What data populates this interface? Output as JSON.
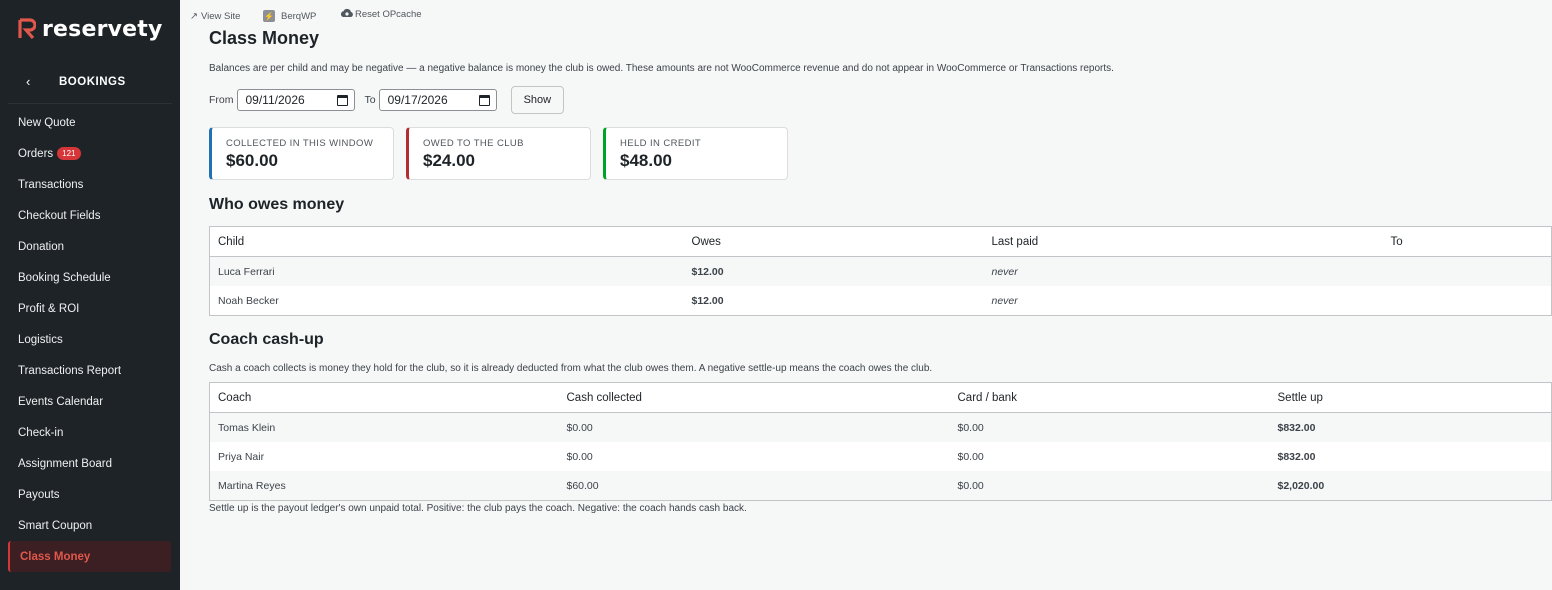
{
  "brand": {
    "name": "reservety",
    "accent": "#e2574c"
  },
  "sidebar": {
    "section_title": "BOOKINGS",
    "items": [
      {
        "label": "New Quote"
      },
      {
        "label": "Orders",
        "badge": "121"
      },
      {
        "label": "Transactions"
      },
      {
        "label": "Checkout Fields"
      },
      {
        "label": "Donation"
      },
      {
        "label": "Booking Schedule"
      },
      {
        "label": "Profit & ROI"
      },
      {
        "label": "Logistics"
      },
      {
        "label": "Transactions Report"
      },
      {
        "label": "Events Calendar"
      },
      {
        "label": "Check-in"
      },
      {
        "label": "Assignment Board"
      },
      {
        "label": "Payouts"
      },
      {
        "label": "Smart Coupon"
      },
      {
        "label": "Class Money",
        "active": true
      }
    ]
  },
  "topbar": {
    "view_site": "View Site",
    "berqwp": "BerqWP",
    "reset_opcache": "Reset OPcache"
  },
  "page": {
    "title": "Class Money",
    "note": "Balances are per child and may be negative — a negative balance is money the club is owed. These amounts are not WooCommerce revenue and do not appear in WooCommerce or Transactions reports.",
    "filter": {
      "from_label": "From",
      "from_value": "09/11/2026",
      "to_label": "To",
      "to_value": "09/17/2026",
      "show_button": "Show"
    }
  },
  "cards": {
    "collected": {
      "label": "COLLECTED IN THIS WINDOW",
      "value": "$60.00",
      "color": "#2271b1"
    },
    "owed": {
      "label": "OWED TO THE CLUB",
      "value": "$24.00",
      "color": "#b32d2e"
    },
    "credit": {
      "label": "HELD IN CREDIT",
      "value": "$48.00",
      "color": "#00a32a"
    }
  },
  "owes": {
    "heading": "Who owes money",
    "columns": [
      "Child",
      "Owes",
      "Last paid",
      "To"
    ],
    "rows": [
      {
        "child": "Luca Ferrari",
        "owes": "$12.00",
        "last_paid": "never"
      },
      {
        "child": "Noah Becker",
        "owes": "$12.00",
        "last_paid": "never"
      }
    ]
  },
  "coach": {
    "heading": "Coach cash-up",
    "note": "Cash a coach collects is money they hold for the club, so it is already deducted from what the club owes them. A negative settle-up means the coach owes the club.",
    "columns": [
      "Coach",
      "Cash collected",
      "Card / bank",
      "Settle up"
    ],
    "rows": [
      {
        "coach": "Tomas Klein",
        "cash": "$0.00",
        "card": "$0.00",
        "settle": "$832.00"
      },
      {
        "coach": "Priya Nair",
        "cash": "$0.00",
        "card": "$0.00",
        "settle": "$832.00"
      },
      {
        "coach": "Martina Reyes",
        "cash": "$60.00",
        "card": "$0.00",
        "settle": "$2,020.00"
      }
    ],
    "footnote": "Settle up is the payout ledger's own unpaid total. Positive: the club pays the coach. Negative: the coach hands cash back."
  }
}
